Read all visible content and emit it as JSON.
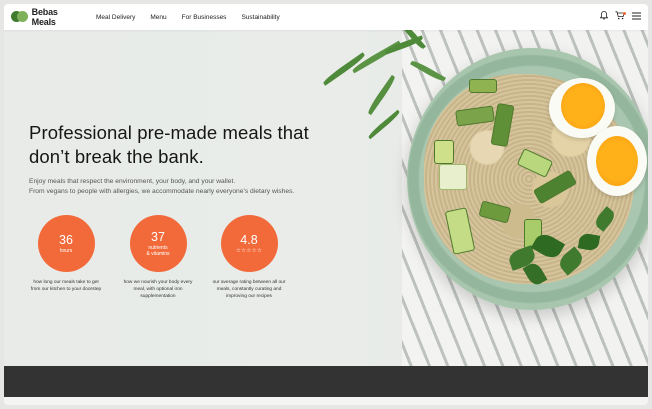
{
  "brand": {
    "name": "Bebas Meals"
  },
  "nav": {
    "items": [
      "Meal Delivery",
      "Menu",
      "For Businesses",
      "Sustainability"
    ],
    "icons": [
      "bell-icon",
      "cart-icon",
      "hamburger-menu-icon"
    ]
  },
  "hero": {
    "title_line1": "Professional pre-made meals that",
    "title_line2": "don’t break the bank.",
    "subtitle_line1": "Enjoy meals that respect the environment, your body, and your wallet.",
    "subtitle_line2": "From vegans to people with allergies, we accommodate nearly everyone’s dietary wishes."
  },
  "stats": [
    {
      "value": "36",
      "unit": "hours",
      "caption_line1": "how long our meals take to get",
      "caption_line2": "from our kitchen to your doorstep",
      "caption_line3": ""
    },
    {
      "value": "37",
      "unit": "nutrients",
      "unit2": "& vitamins",
      "caption_line1": "how we nourish your body every",
      "caption_line2": "meal, with optional iron",
      "caption_line3": "supplementation"
    },
    {
      "value": "4.8",
      "unit": "☆☆☆☆☆",
      "caption_line1": "our average rating between all our",
      "caption_line2": "meals, constantly curating and",
      "caption_line3": "improving our recipes"
    }
  ],
  "colors": {
    "accent": "#f26a3a",
    "footer": "#333333",
    "logo_green": "#3f7a2e"
  }
}
